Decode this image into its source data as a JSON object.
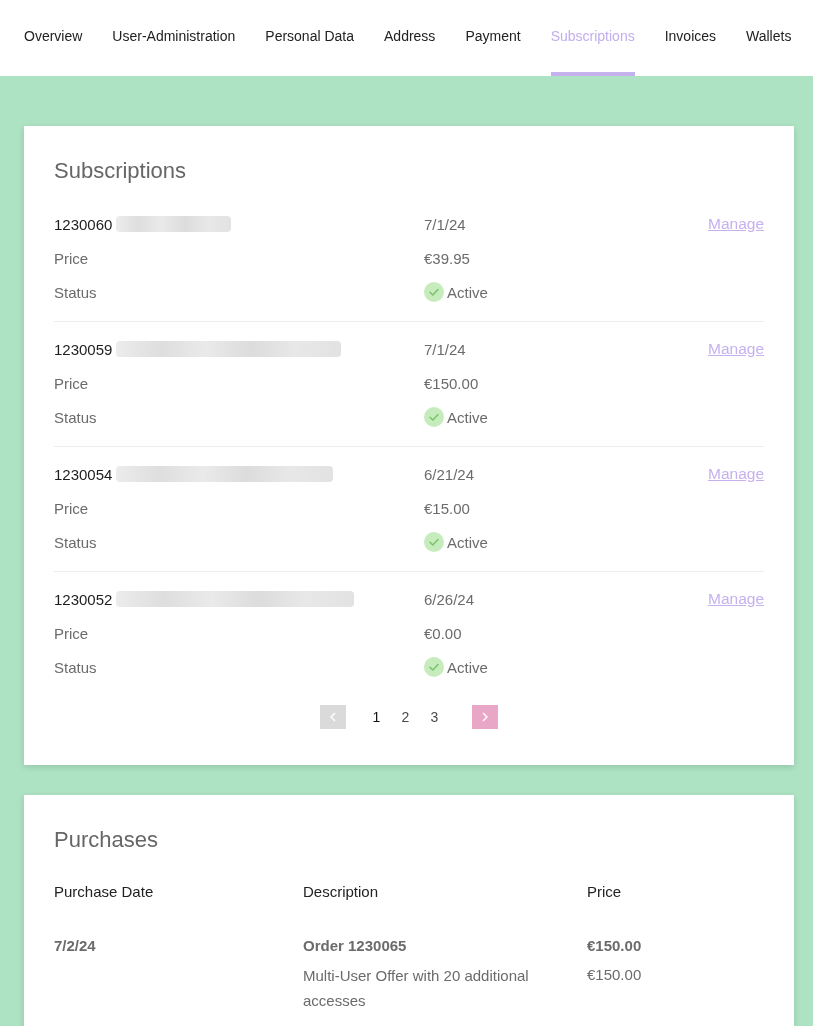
{
  "nav": {
    "tabs": [
      {
        "label": "Overview",
        "selected": false
      },
      {
        "label": "User-Administration",
        "selected": false
      },
      {
        "label": "Personal Data",
        "selected": false
      },
      {
        "label": "Address",
        "selected": false
      },
      {
        "label": "Payment",
        "selected": false
      },
      {
        "label": "Subscriptions",
        "selected": true
      },
      {
        "label": "Invoices",
        "selected": false
      },
      {
        "label": "Wallets",
        "selected": false
      }
    ]
  },
  "subscriptions": {
    "title": "Subscriptions",
    "items": [
      {
        "number": "1230060",
        "name_blurred": true,
        "date": "7/1/24",
        "action": "Manage",
        "price_label": "Price",
        "price": "€39.95",
        "status_label": "Status",
        "status": "Active"
      },
      {
        "number": "1230059",
        "name_blurred": true,
        "date": "7/1/24",
        "action": "Manage",
        "price_label": "Price",
        "price": "€150.00",
        "status_label": "Status",
        "status": "Active"
      },
      {
        "number": "1230054",
        "name_blurred": true,
        "date": "6/21/24",
        "action": "Manage",
        "price_label": "Price",
        "price": "€15.00",
        "status_label": "Status",
        "status": "Active"
      },
      {
        "number": "1230052",
        "name_blurred": true,
        "date": "6/26/24",
        "action": "Manage",
        "price_label": "Price",
        "price": "€0.00",
        "status_label": "Status",
        "status": "Active"
      }
    ],
    "pagination": {
      "prev": {
        "disabled": true
      },
      "pages": [
        {
          "label": "1",
          "selected": true
        },
        {
          "label": "2",
          "selected": false
        },
        {
          "label": "3",
          "selected": false
        }
      ],
      "next": {
        "disabled": false
      }
    }
  },
  "purchases": {
    "title": "Purchases",
    "columns": [
      "Purchase Date",
      "Description",
      "Price"
    ],
    "rows": [
      {
        "date": "7/2/24",
        "order": "Order 1230065",
        "total": "€150.00",
        "description": "Multi-User Offer with 20 additional accesses",
        "item_price": "€150.00"
      }
    ]
  }
}
